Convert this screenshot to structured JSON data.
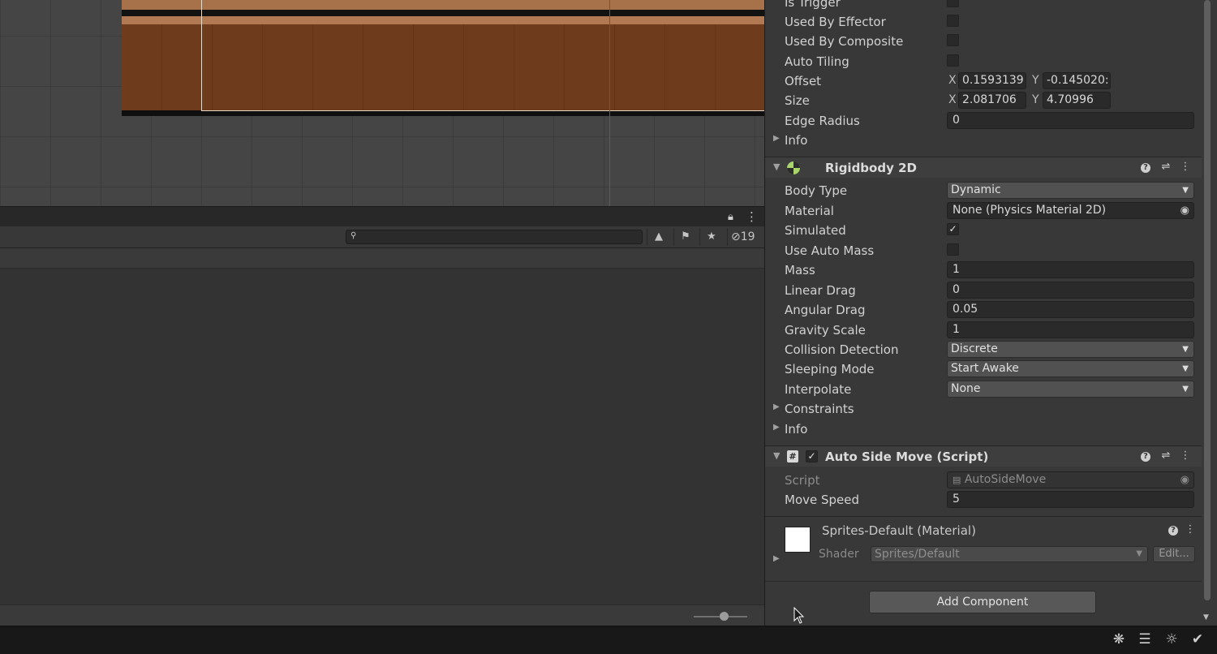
{
  "panel": {
    "hidden_count": "19",
    "icons": [
      "lock-icon",
      "kebab-menu-icon",
      "search-icon",
      "filter-by-type-icon",
      "filter-by-label-icon",
      "favorite-star-icon",
      "hidden-eye-icon"
    ]
  },
  "inspector": {
    "collider_props": {
      "is_trigger": "Is Trigger",
      "used_by_effector": "Used By Effector",
      "used_by_composite": "Used By Composite",
      "auto_tiling": "Auto Tiling",
      "offset": {
        "label": "Offset",
        "x_label": "X",
        "x": "0.1593139",
        "y_label": "Y",
        "y": "-0.145020:"
      },
      "size": {
        "label": "Size",
        "x_label": "X",
        "x": "2.081706",
        "y_label": "Y",
        "y": "4.70996"
      },
      "edge_radius": {
        "label": "Edge Radius",
        "value": "0"
      },
      "info": "Info"
    },
    "rigidbody": {
      "title": "Rigidbody 2D",
      "body_type": {
        "label": "Body Type",
        "value": "Dynamic"
      },
      "material": {
        "label": "Material",
        "value": "None (Physics Material 2D)"
      },
      "simulated": {
        "label": "Simulated",
        "checked": true
      },
      "use_auto_mass": {
        "label": "Use Auto Mass",
        "checked": false
      },
      "mass": {
        "label": "Mass",
        "value": "1"
      },
      "linear_drag": {
        "label": "Linear Drag",
        "value": "0"
      },
      "angular_drag": {
        "label": "Angular Drag",
        "value": "0.05"
      },
      "gravity_scale": {
        "label": "Gravity Scale",
        "value": "1"
      },
      "collision_detection": {
        "label": "Collision Detection",
        "value": "Discrete"
      },
      "sleeping_mode": {
        "label": "Sleeping Mode",
        "value": "Start Awake"
      },
      "interpolate": {
        "label": "Interpolate",
        "value": "None"
      },
      "constraints": "Constraints",
      "info": "Info"
    },
    "script_component": {
      "title": "Auto Side Move (Script)",
      "script": {
        "label": "Script",
        "value": "AutoSideMove"
      },
      "move_speed": {
        "label": "Move Speed",
        "value": "5"
      }
    },
    "material_section": {
      "title": "Sprites-Default (Material)",
      "shader_label": "Shader",
      "shader_value": "Sprites/Default",
      "edit": "Edit..."
    },
    "add_component": "Add Component"
  },
  "colors": {
    "scene_bg": "#454545",
    "ground_brown": "#6e3c1c",
    "ground_top": "#b27a52",
    "inspector_bg": "#383838",
    "field_bg": "#2a2a2a",
    "rigidbody_icon": "#a8d66a"
  },
  "statusbar": {
    "icons": [
      "debug-off-icon",
      "cache-server-icon",
      "auto-lighting-icon",
      "progress-ok-icon"
    ]
  }
}
